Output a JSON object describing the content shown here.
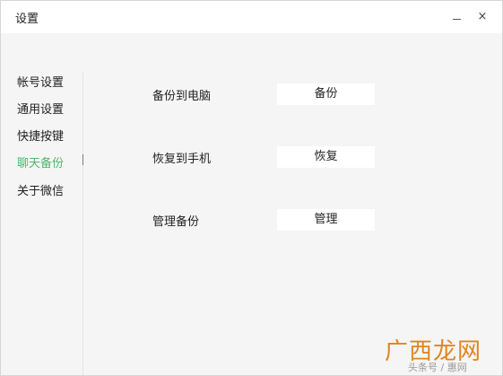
{
  "window": {
    "title": "设置",
    "minimize_label": "–",
    "close_label": "×"
  },
  "sidebar": {
    "items": [
      {
        "label": "帐号设置",
        "active": false
      },
      {
        "label": "通用设置",
        "active": false
      },
      {
        "label": "快捷按键",
        "active": false
      },
      {
        "label": "聊天备份",
        "active": true
      },
      {
        "label": "关于微信",
        "active": false
      }
    ]
  },
  "main": {
    "rows": [
      {
        "label": "备份到电脑",
        "button": "备份"
      },
      {
        "label": "恢复到手机",
        "button": "恢复"
      },
      {
        "label": "管理备份",
        "button": "管理"
      }
    ]
  },
  "watermark": {
    "logo_text": "广西龙网",
    "caption": "头条号 / 惠网"
  },
  "colors": {
    "active_nav": "#4db86b",
    "watermark": "#e08522"
  }
}
